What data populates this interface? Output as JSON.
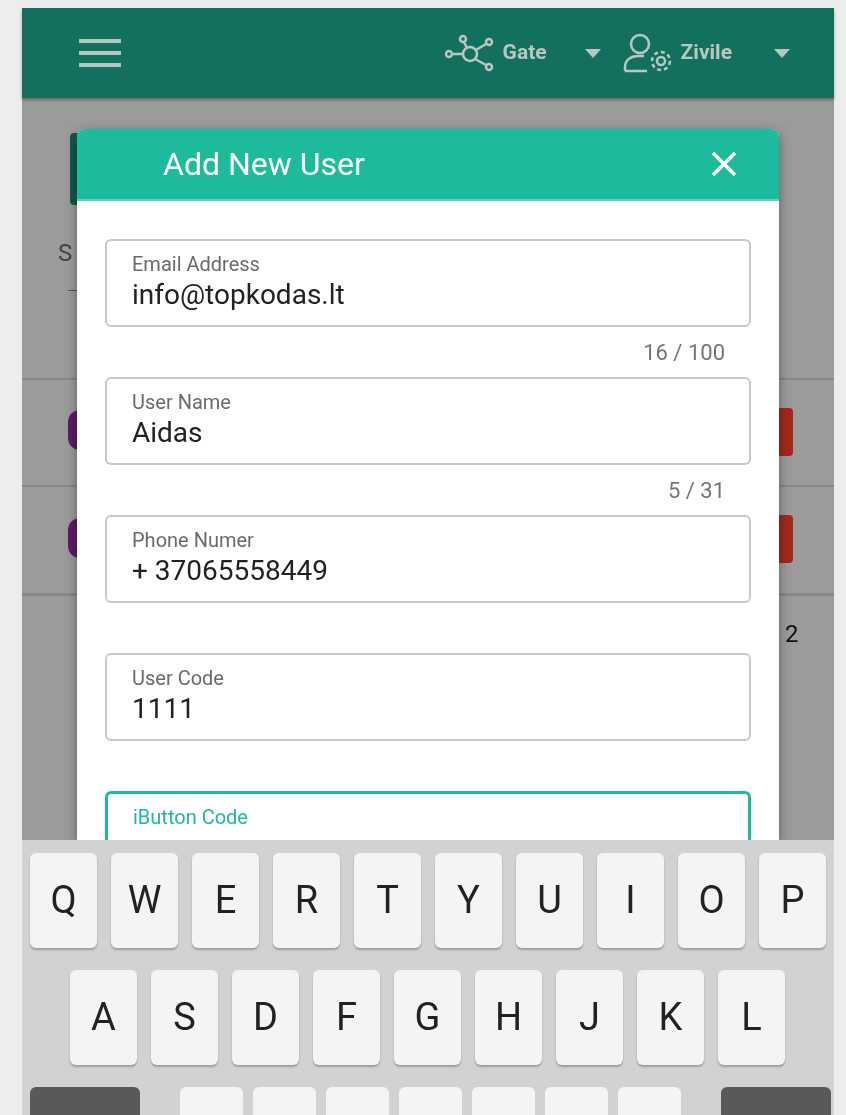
{
  "header": {
    "workspace": "Gate",
    "user": "Zivile"
  },
  "background": {
    "text_1": "S",
    "text_2": "2"
  },
  "dialog": {
    "title": "Add New User",
    "fields": [
      {
        "label": "Email Address",
        "value": "info@topkodas.lt",
        "counter": "16 / 100",
        "focused": false
      },
      {
        "label": "User Name",
        "value": "Aidas",
        "counter": "5 / 31",
        "focused": false
      },
      {
        "label": "Phone Numer",
        "value": "+ 37065558449",
        "focused": false
      },
      {
        "label": "User Code",
        "value": "1111",
        "focused": false
      },
      {
        "label": "iButton Code",
        "focused": true
      }
    ]
  },
  "keyboard": {
    "rows": [
      [
        "Q",
        "W",
        "E",
        "R",
        "T",
        "Y",
        "U",
        "I",
        "O",
        "P"
      ],
      [
        "A",
        "S",
        "D",
        "F",
        "G",
        "H",
        "J",
        "K",
        "L"
      ]
    ],
    "row_3": [
      {
        "kind": "function"
      },
      {
        "kind": "letter"
      },
      {
        "kind": "letter"
      },
      {
        "kind": "letter"
      },
      {
        "kind": "letter"
      },
      {
        "kind": "letter"
      },
      {
        "kind": "letter"
      },
      {
        "kind": "letter"
      },
      {
        "kind": "function"
      }
    ]
  }
}
